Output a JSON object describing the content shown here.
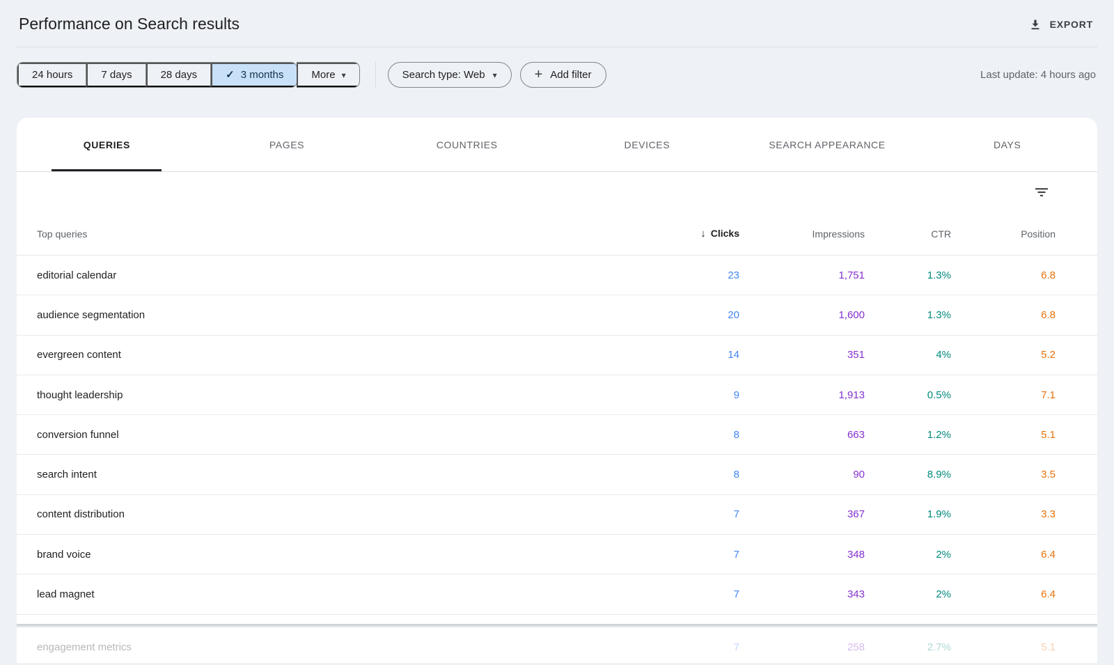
{
  "page": {
    "title": "Performance on Search results",
    "export_label": "EXPORT",
    "last_update": "Last update: 4 hours ago"
  },
  "toolbar": {
    "date_ranges": [
      {
        "label": "24 hours",
        "selected": false
      },
      {
        "label": "7 days",
        "selected": false
      },
      {
        "label": "28 days",
        "selected": false
      },
      {
        "label": "3 months",
        "selected": true
      }
    ],
    "more_label": "More",
    "search_type_label": "Search type: Web",
    "add_filter_label": "Add filter"
  },
  "tabs": [
    {
      "label": "QUERIES",
      "active": true
    },
    {
      "label": "PAGES",
      "active": false
    },
    {
      "label": "COUNTRIES",
      "active": false
    },
    {
      "label": "DEVICES",
      "active": false
    },
    {
      "label": "SEARCH APPEARANCE",
      "active": false
    },
    {
      "label": "DAYS",
      "active": false
    }
  ],
  "table": {
    "first_col_header": "Top queries",
    "headers": {
      "clicks": "Clicks",
      "impressions": "Impressions",
      "ctr": "CTR",
      "position": "Position"
    },
    "sorted_by": "Clicks",
    "sort_direction": "desc",
    "rows": [
      {
        "query": "editorial calendar",
        "clicks": "23",
        "impressions": "1,751",
        "ctr": "1.3%",
        "position": "6.8",
        "faded": false
      },
      {
        "query": "audience segmentation",
        "clicks": "20",
        "impressions": "1,600",
        "ctr": "1.3%",
        "position": "6.8",
        "faded": false
      },
      {
        "query": "evergreen content",
        "clicks": "14",
        "impressions": "351",
        "ctr": "4%",
        "position": "5.2",
        "faded": false
      },
      {
        "query": "thought leadership",
        "clicks": "9",
        "impressions": "1,913",
        "ctr": "0.5%",
        "position": "7.1",
        "faded": false
      },
      {
        "query": "conversion funnel",
        "clicks": "8",
        "impressions": "663",
        "ctr": "1.2%",
        "position": "5.1",
        "faded": false
      },
      {
        "query": "search intent",
        "clicks": "8",
        "impressions": "90",
        "ctr": "8.9%",
        "position": "3.5",
        "faded": false
      },
      {
        "query": "content distribution",
        "clicks": "7",
        "impressions": "367",
        "ctr": "1.9%",
        "position": "3.3",
        "faded": false
      },
      {
        "query": "brand voice",
        "clicks": "7",
        "impressions": "348",
        "ctr": "2%",
        "position": "6.4",
        "faded": false
      },
      {
        "query": "lead magnet",
        "clicks": "7",
        "impressions": "343",
        "ctr": "2%",
        "position": "6.4",
        "faded": false
      },
      {
        "query": "engagement metrics",
        "clicks": "7",
        "impressions": "258",
        "ctr": "2.7%",
        "position": "5.1",
        "faded": true
      }
    ]
  },
  "icons": {
    "export": "download-icon",
    "selected_check": "✓",
    "dropdown_caret": "▾",
    "add_filter_plus": "+",
    "sort_desc_arrow": "↓",
    "table_filter": "filter-list-icon"
  },
  "colors": {
    "clicks": "#4285f4",
    "impressions": "#8430ce",
    "ctr": "#00897b",
    "position": "#e8710a",
    "accent_chip_bg": "#c8e1f8",
    "page_bg": "#eef1f6",
    "card_bg": "#ffffff"
  }
}
